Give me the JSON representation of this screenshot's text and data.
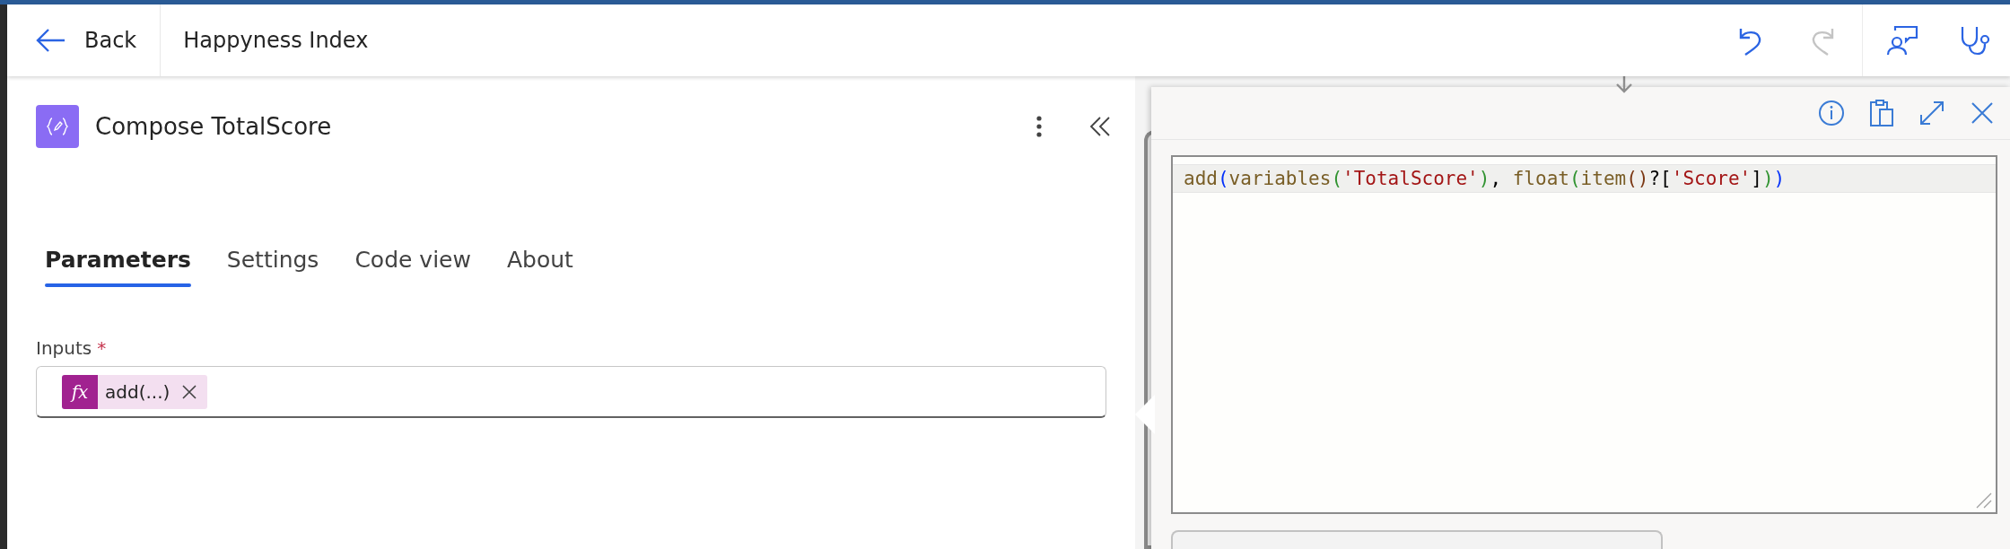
{
  "header": {
    "back_label": "Back",
    "title": "Happyness Index",
    "undo_disabled": false,
    "redo_disabled": true
  },
  "panel": {
    "title": "Compose TotalScore",
    "tabs": [
      {
        "label": "Parameters",
        "selected": true
      },
      {
        "label": "Settings",
        "selected": false
      },
      {
        "label": "Code view",
        "selected": false
      },
      {
        "label": "About",
        "selected": false
      }
    ],
    "inputs": {
      "label": "Inputs",
      "required_mark": "*",
      "token": {
        "icon_text": "fx",
        "label": "add(...)"
      }
    }
  },
  "expression_editor": {
    "code": [
      {
        "text": "add",
        "kind": "function"
      },
      {
        "text": "(",
        "kind": "bracket1"
      },
      {
        "text": "variables",
        "kind": "function"
      },
      {
        "text": "(",
        "kind": "bracket2"
      },
      {
        "text": "'TotalScore'",
        "kind": "string"
      },
      {
        "text": ")",
        "kind": "bracket2"
      },
      {
        "text": ", ",
        "kind": "punct"
      },
      {
        "text": "float",
        "kind": "function"
      },
      {
        "text": "(",
        "kind": "bracket2"
      },
      {
        "text": "item",
        "kind": "function"
      },
      {
        "text": "()",
        "kind": "bracket3"
      },
      {
        "text": "?[",
        "kind": "punct"
      },
      {
        "text": "'Score'",
        "kind": "string"
      },
      {
        "text": "]",
        "kind": "punct"
      },
      {
        "text": ")",
        "kind": "bracket2"
      },
      {
        "text": ")",
        "kind": "bracket1"
      }
    ]
  }
}
